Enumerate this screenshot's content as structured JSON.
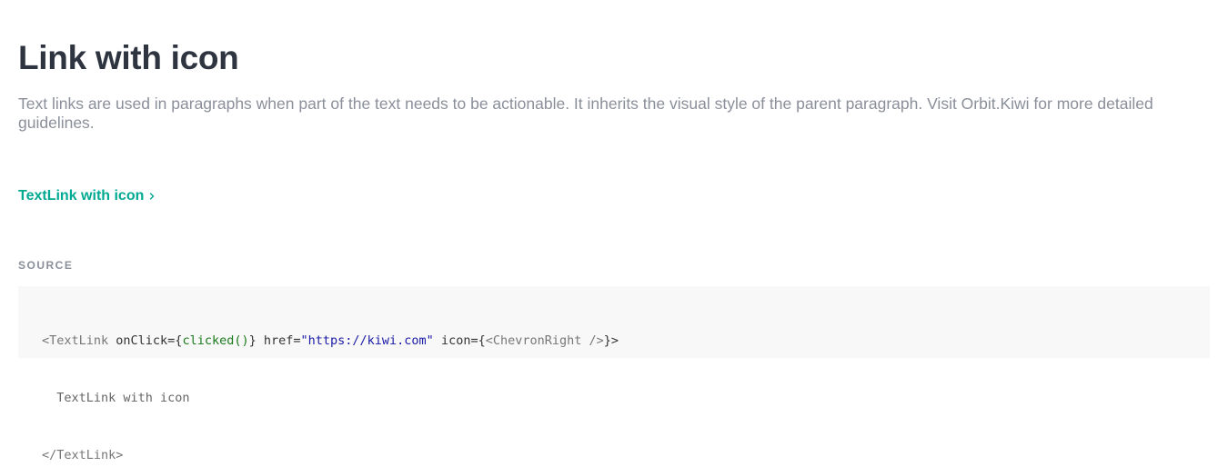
{
  "header": {
    "title": "Link with icon",
    "description": "Text links are used in paragraphs when part of the text needs to be actionable. It inherits the visual style of the parent paragraph. Visit Orbit.Kiwi for more detailed guidelines."
  },
  "demo": {
    "link_label": "TextLink with icon",
    "icon": "chevron-right-icon",
    "link_color": "#00a991"
  },
  "source": {
    "label": "SOURCE",
    "line1": {
      "open_tag": "<TextLink",
      "attr_onclick": " onClick={",
      "onclick_value": "clicked()",
      "attr_href": "} href=",
      "href_value": "\"https://kiwi.com\"",
      "attr_icon": " icon={",
      "icon_value": "<ChevronRight />",
      "close": "}>"
    },
    "line2": "  TextLink with icon",
    "line3": "</TextLink>"
  }
}
